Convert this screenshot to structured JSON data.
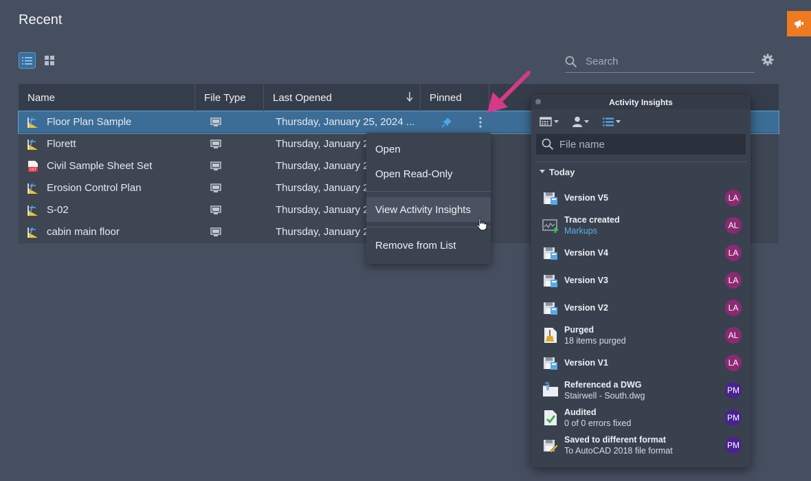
{
  "page": {
    "title": "Recent"
  },
  "search": {
    "placeholder": "Search"
  },
  "table": {
    "columns": [
      "Name",
      "File Type",
      "Last Opened",
      "Pinned"
    ],
    "rows": [
      {
        "name": "Floor Plan Sample",
        "icon": "dwg-file-icon",
        "file_type_icon": "desktop-icon",
        "last_opened": "Thursday, January 25, 2024 ...",
        "pinned": true,
        "selected": true
      },
      {
        "name": "Florett",
        "icon": "dwg-file-icon",
        "file_type_icon": "desktop-icon",
        "last_opened": "Thursday, January 2",
        "pinned": false
      },
      {
        "name": "Civil Sample Sheet Set",
        "icon": "dst-file-icon",
        "file_type_icon": "desktop-icon",
        "last_opened": "Thursday, January 2",
        "pinned": false
      },
      {
        "name": "Erosion Control Plan",
        "icon": "dwg-file-icon",
        "file_type_icon": "desktop-icon",
        "last_opened": "Thursday, January 2",
        "pinned": false
      },
      {
        "name": "S-02",
        "icon": "dwg-file-icon",
        "file_type_icon": "desktop-icon",
        "last_opened": "Thursday, January 2",
        "pinned": false
      },
      {
        "name": "cabin main floor",
        "icon": "dwg-file-icon",
        "file_type_icon": "desktop-icon",
        "last_opened": "Thursday, January 2",
        "pinned": false
      }
    ]
  },
  "context_menu": {
    "items": [
      "Open",
      "Open Read-Only",
      "View Activity Insights",
      "Remove from List"
    ],
    "hovered": "View Activity Insights"
  },
  "activity_panel": {
    "title": "Activity Insights",
    "search_placeholder": "File name",
    "section": "Today",
    "items": [
      {
        "title": "Version V5",
        "sub": "",
        "icon": "save-version-icon",
        "avatar": "LA"
      },
      {
        "title": "Trace created",
        "sub": "Markups",
        "sub_link": true,
        "icon": "trace-icon",
        "avatar": "AL"
      },
      {
        "title": "Version V4",
        "sub": "",
        "icon": "save-version-icon",
        "avatar": "LA"
      },
      {
        "title": "Version V3",
        "sub": "",
        "icon": "save-version-icon",
        "avatar": "LA"
      },
      {
        "title": "Version V2",
        "sub": "",
        "icon": "save-version-icon",
        "avatar": "LA"
      },
      {
        "title": "Purged",
        "sub": "18 items purged",
        "icon": "purge-icon",
        "avatar": "AL"
      },
      {
        "title": "Version V1",
        "sub": "",
        "icon": "save-version-icon",
        "avatar": "LA"
      },
      {
        "title": "Referenced a DWG",
        "sub": "Stairwell - South.dwg",
        "icon": "xref-icon",
        "avatar": "PM"
      },
      {
        "title": "Audited",
        "sub": "0 of 0 errors fixed",
        "icon": "audit-icon",
        "avatar": "PM"
      },
      {
        "title": "Saved to different format",
        "sub": "To AutoCAD 2018 file format",
        "icon": "save-as-icon",
        "avatar": "PM"
      }
    ]
  },
  "colors": {
    "background": "#464f60",
    "selected_row": "#3c6d96",
    "accent_orange": "#f07a20",
    "annotation_arrow": "#d63a86",
    "avatar_la": "#8b2a72",
    "avatar_pm": "#4a2290",
    "link": "#54b3ea"
  }
}
